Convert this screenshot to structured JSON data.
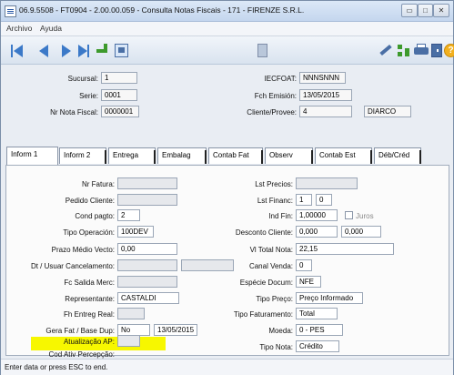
{
  "window": {
    "title": "06.9.5508 - FT0904 - 2.00.00.059 - Consulta Notas Fiscais - 171 - FIRENZE S.R.L.",
    "controls": {
      "minimize": "▭",
      "maximize": "□",
      "close": "✕"
    }
  },
  "menu": [
    "Archivo",
    "Ayuda"
  ],
  "toolbar_icons": [
    "first-record-icon",
    "previous-record-icon",
    "next-record-icon",
    "last-record-icon",
    "enter-icon",
    "calculator-icon",
    "document-icon",
    "tools-icon",
    "tree-icon",
    "printer-icon",
    "exit-door-icon",
    "help-icon"
  ],
  "help_glyph": "?",
  "header": {
    "sucursal_label": "Sucursal:",
    "sucursal_value": "1",
    "serie_label": "Serie:",
    "serie_value": "0001",
    "nr_nota_label": "Nr Nota Fiscal:",
    "nr_nota_value": "0000001",
    "iecfoat_label": "IECFOAT:",
    "iecfoat_value": "NNNSNNN",
    "fch_emision_label": "Fch Emisión:",
    "fch_emision_value": "13/05/2015",
    "cliente_label": "Cliente/Provee:",
    "cliente_code": "4",
    "cliente_name": "DIARCO"
  },
  "tabs": [
    "Inform 1",
    "Inform 2",
    "Entrega",
    "Embalag",
    "Contab Fat",
    "Observ",
    "Contab Est",
    "Déb/Créd"
  ],
  "form": {
    "nr_fatura_label": "Nr Fatura:",
    "nr_fatura_value": "",
    "pedido_cliente_label": "Pedido Cliente:",
    "pedido_cliente_value": "",
    "cond_pagto_label": "Cond pagto:",
    "cond_pagto_value": "2",
    "tipo_operacao_label": "Tipo Operación:",
    "tipo_operacao_value": "100DEV",
    "prazo_medio_label": "Prazo Médio Vecto:",
    "prazo_medio_value": "0,00",
    "dt_usuar_label": "Dt / Usuar Cancelamento:",
    "dt_value": "",
    "usuar_value": "",
    "fc_salida_label": "Fc Salida Merc:",
    "fc_salida_value": "",
    "representante_label": "Representante:",
    "representante_value": "CASTALDI",
    "fh_entreg_label": "Fh Entreg Real:",
    "fh_entreg_value": "",
    "gera_fat_label": "Gera Fat / Base Dup:",
    "gera_fat_value": "No",
    "base_dup_value": "13/05/2015",
    "atualizacao_label": "Atualização AP:",
    "atualizacao_value": "",
    "cod_ativ_label": "Cod Ativ Percepção:",
    "cod_ativ_value": "",
    "lst_precios_label": "Lst Precios:",
    "lst_precios_value": "",
    "lst_financ_label": "Lst Financ:",
    "lst_financ_value1": "1",
    "lst_financ_value2": "0",
    "ind_fin_label": "Ind Fin:",
    "ind_fin_value": "1,00000",
    "juros_label": "Juros",
    "desconto_label": "Desconto Cliente:",
    "desconto_value1": "0,000",
    "desconto_value2": "0,000",
    "vl_total_label": "Vl Total Nota:",
    "vl_total_value": "22,15",
    "canal_venda_label": "Canal Venda:",
    "canal_venda_value": "0",
    "especie_label": "Espécie Docum:",
    "especie_value": "NFE",
    "tipo_preco_label": "Tipo Preço:",
    "tipo_preco_value": "Preço Informado",
    "tipo_faturamento_label": "Tipo Faturamento:",
    "tipo_faturamento_value": "Total",
    "moeda_label": "Moeda:",
    "moeda_value": "0 - PES",
    "tipo_nota_label": "Tipo Nota:",
    "tipo_nota_value": "Crédito"
  },
  "status": {
    "text": "Enter data or press ESC to end."
  },
  "colors": {
    "highlight": "#f7f700",
    "nav_blue": "#3b79c8"
  }
}
